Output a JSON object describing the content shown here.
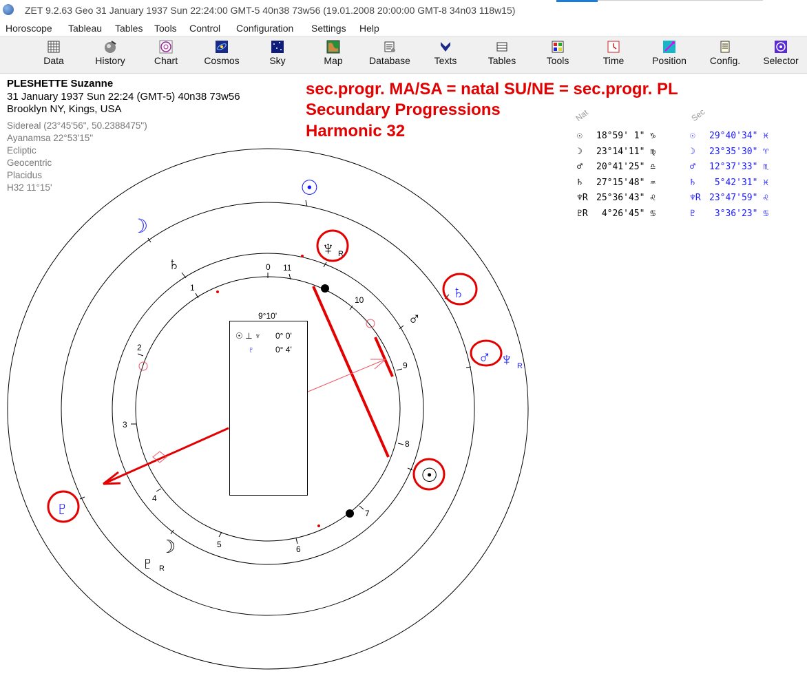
{
  "window": {
    "title": "ZET 9.2.63 Geo    31 January 1937  Sun  22:24:00 GMT-5 40n38  73w56  (19.01.2008  20:00:00 GMT-8 34n03 118w15)"
  },
  "menu": [
    "Horoscope",
    "Tableau",
    "Tables",
    "Tools",
    "Control",
    "Configuration",
    "Settings",
    "Help"
  ],
  "toolbar": [
    {
      "label": "Data",
      "icon": "data-icon"
    },
    {
      "label": "History",
      "icon": "history-icon"
    },
    {
      "label": "Chart",
      "icon": "chart-icon"
    },
    {
      "label": "Cosmos",
      "icon": "cosmos-icon"
    },
    {
      "label": "Sky",
      "icon": "sky-icon"
    },
    {
      "label": "Map",
      "icon": "map-icon"
    },
    {
      "label": "Database",
      "icon": "database-icon"
    },
    {
      "label": "Texts",
      "icon": "texts-icon"
    },
    {
      "label": "Tables",
      "icon": "tables-icon"
    },
    {
      "label": "Tools",
      "icon": "tools-icon"
    },
    {
      "label": "Time",
      "icon": "time-icon"
    },
    {
      "label": "Position",
      "icon": "position-icon"
    },
    {
      "label": "Config.",
      "icon": "config-icon"
    },
    {
      "label": "Selector",
      "icon": "selector-icon"
    }
  ],
  "header": {
    "name": "PLESHETTE Suzanne",
    "date_line": "31 January 1937  Sun  22:24 (GMT-5) 40n38  73w56",
    "place": "Brooklyn NY, Kings, USA",
    "zodiac": "Sidereal (23°45'56\", 50.2388475\")",
    "ayanamsa": "Ayanamsa 22°53'15\"",
    "ecliptic": "Ecliptic",
    "geocentric": "Geocentric",
    "houses": "Placidus",
    "harmonic": "H32  11°15'"
  },
  "annotations": [
    "sec.progr. MA/SA = natal SU/NE = sec.progr. PL",
    "Secundary Progressions",
    "Harmonic 32"
  ],
  "table": {
    "natal_header": "Nat",
    "sec_header": "Sec",
    "natal": [
      {
        "glyph": "☉",
        "value": "18°59' 1\"",
        "sign": "♑"
      },
      {
        "glyph": "☽",
        "value": "23°14'11\"",
        "sign": "♍"
      },
      {
        "glyph": "♂",
        "value": "20°41'25\"",
        "sign": "♎"
      },
      {
        "glyph": "♄",
        "value": "27°15'48\"",
        "sign": "♒"
      },
      {
        "glyph": "♆R",
        "value": "25°36'43\"",
        "sign": "♌"
      },
      {
        "glyph": "♇R",
        "value": " 4°26'45\"",
        "sign": "♋"
      }
    ],
    "sec": [
      {
        "glyph": "☉",
        "value": "29°40'34\"",
        "sign": "♓"
      },
      {
        "glyph": "☽",
        "value": "23°35'30\"",
        "sign": "♈"
      },
      {
        "glyph": "♂",
        "value": "12°37'33\"",
        "sign": "♏"
      },
      {
        "glyph": "♄",
        "value": " 5°42'31\"",
        "sign": "♓"
      },
      {
        "glyph": "♆R",
        "value": "23°47'59\"",
        "sign": "♌"
      },
      {
        "glyph": "♇",
        "value": " 3°36'23\"",
        "sign": "♋"
      }
    ]
  },
  "aspect_box": {
    "title": "9°10'",
    "row1_glyphs": "☉ ⊥ ♆",
    "row1_value": "0° 0'",
    "row2_glyph": "♇",
    "row2_value": "0° 4'"
  },
  "house_labels": [
    "1",
    "2",
    "3",
    "4",
    "5",
    "6",
    "7",
    "8",
    "9",
    "10",
    "11"
  ],
  "house_zero": "0",
  "chart_glyphs": {
    "sun_sec": "☉",
    "moon_sec": "☽",
    "saturn_natal": "♄",
    "neptune_natal": "♆",
    "saturn_sec": "♄",
    "mars_natal": "♂",
    "mars_sec": "♂",
    "neptune_sec": "♆",
    "sun_natal": "☉",
    "pluto_sec": "♇",
    "moon_natal": "☽",
    "pluto_natal": "♇",
    "retro": "R"
  },
  "colors": {
    "annotation": "#e30000",
    "secondary": "#1a1aff",
    "natal": "#000000"
  }
}
